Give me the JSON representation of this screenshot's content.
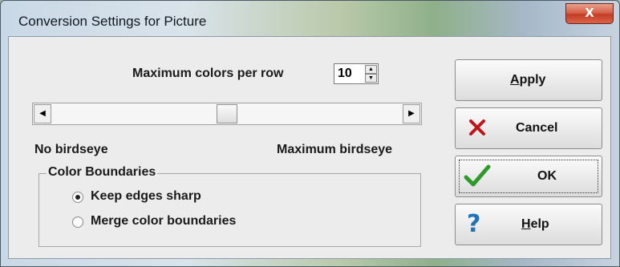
{
  "window": {
    "title": "Conversion Settings for Picture",
    "close_label": "X"
  },
  "max_colors": {
    "label": "Maximum colors per row",
    "value": "10"
  },
  "birdseye": {
    "min_label": "No birdseye",
    "max_label": "Maximum birdseye",
    "level_fraction": 0.5
  },
  "color_boundaries": {
    "legend": "Color Boundaries",
    "options": [
      {
        "label": "Keep edges sharp",
        "selected": true
      },
      {
        "label": "Merge color boundaries",
        "selected": false
      }
    ]
  },
  "buttons": {
    "apply": {
      "first": "A",
      "rest": "pply"
    },
    "cancel": {
      "label": "Cancel"
    },
    "ok": {
      "label": "OK"
    },
    "help": {
      "first": "H",
      "rest": "elp"
    }
  },
  "icons": {
    "cancel": "red-x-icon",
    "ok": "green-checkmark-icon",
    "help": "question-mark-icon"
  },
  "colors": {
    "cancel_icon": "#c0141b",
    "ok_icon": "#2f9a2a",
    "help_icon": "#1f74b7"
  }
}
